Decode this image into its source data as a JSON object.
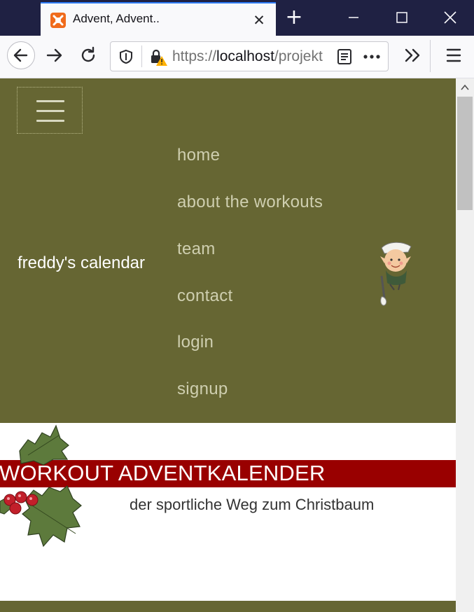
{
  "browser": {
    "tab_title": "Advent, Advent..",
    "url_prefix": "https://",
    "url_host": "localhost",
    "url_path": "/projekt",
    "colors": {
      "tab_strip": "#1f2143",
      "toolbar": "#f9f9fb",
      "accent": "#2f7cf6"
    }
  },
  "site": {
    "brand": "freddy's calendar",
    "menu": [
      {
        "label": "home"
      },
      {
        "label": "about the workouts"
      },
      {
        "label": "team"
      },
      {
        "label": "contact"
      },
      {
        "label": "login"
      },
      {
        "label": "signup"
      }
    ],
    "hero_title": "WORKOUT ADVENTKALENDER",
    "hero_subtitle": "der sportliche Weg zum Christbaum",
    "colors": {
      "nav_bg": "#666633",
      "title_bar": "#990000",
      "menu_text": "#cfcfb0"
    }
  }
}
